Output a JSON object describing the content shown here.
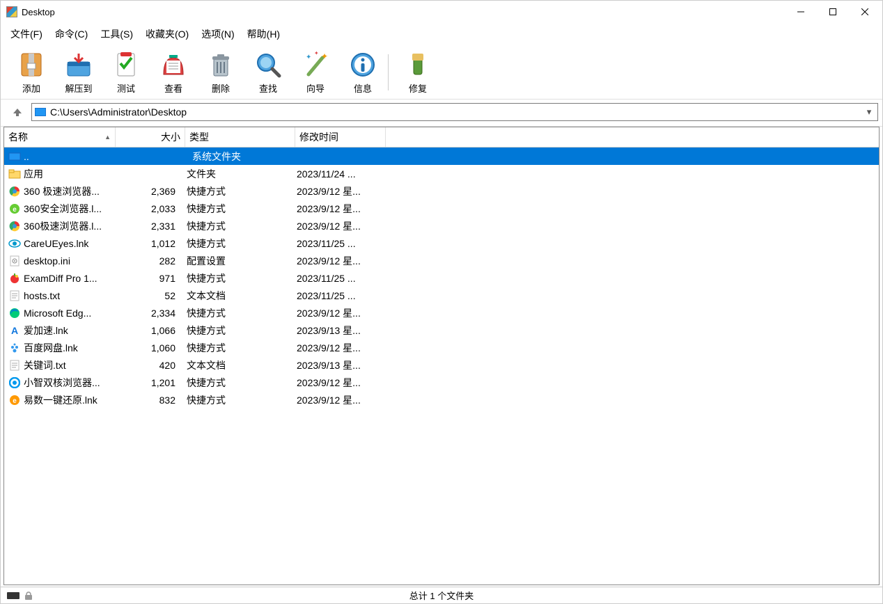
{
  "window": {
    "title": "Desktop"
  },
  "menu": {
    "file": "文件(F)",
    "commands": "命令(C)",
    "tools": "工具(S)",
    "favorites": "收藏夹(O)",
    "options": "选项(N)",
    "help": "帮助(H)"
  },
  "toolbar": {
    "add": "添加",
    "extract": "解压到",
    "test": "测试",
    "view": "查看",
    "delete": "删除",
    "find": "查找",
    "wizard": "向导",
    "info": "信息",
    "repair": "修复"
  },
  "address": {
    "path": "C:\\Users\\Administrator\\Desktop"
  },
  "columns": {
    "name": "名称",
    "size": "大小",
    "type": "类型",
    "modified": "修改时间"
  },
  "parent_row": {
    "name": "..",
    "type": "系统文件夹"
  },
  "files": [
    {
      "icon": "folder",
      "name": "应用",
      "size": "",
      "type": "文件夹",
      "date": "2023/11/24 ..."
    },
    {
      "icon": "chrome360",
      "name": "360 极速浏览器...",
      "size": "2,369",
      "type": "快捷方式",
      "date": "2023/9/12 星..."
    },
    {
      "icon": "green-e",
      "name": "360安全浏览器.l...",
      "size": "2,033",
      "type": "快捷方式",
      "date": "2023/9/12 星..."
    },
    {
      "icon": "chrome360",
      "name": "360极速浏览器.l...",
      "size": "2,331",
      "type": "快捷方式",
      "date": "2023/9/12 星..."
    },
    {
      "icon": "eye",
      "name": "CareUEyes.lnk",
      "size": "1,012",
      "type": "快捷方式",
      "date": "2023/11/25 ..."
    },
    {
      "icon": "ini",
      "name": "desktop.ini",
      "size": "282",
      "type": "配置设置",
      "date": "2023/9/12 星..."
    },
    {
      "icon": "apple",
      "name": "ExamDiff Pro 1...",
      "size": "971",
      "type": "快捷方式",
      "date": "2023/11/25 ..."
    },
    {
      "icon": "txt",
      "name": "hosts.txt",
      "size": "52",
      "type": "文本文档",
      "date": "2023/11/25 ..."
    },
    {
      "icon": "edge",
      "name": "Microsoft Edg...",
      "size": "2,334",
      "type": "快捷方式",
      "date": "2023/9/12 星..."
    },
    {
      "icon": "blue-a",
      "name": "爱加速.lnk",
      "size": "1,066",
      "type": "快捷方式",
      "date": "2023/9/13 星..."
    },
    {
      "icon": "baidu",
      "name": "百度网盘.lnk",
      "size": "1,060",
      "type": "快捷方式",
      "date": "2023/9/12 星..."
    },
    {
      "icon": "txt",
      "name": "关键词.txt",
      "size": "420",
      "type": "文本文档",
      "date": "2023/9/13 星..."
    },
    {
      "icon": "ering",
      "name": "小智双核浏览器...",
      "size": "1,201",
      "type": "快捷方式",
      "date": "2023/9/12 星..."
    },
    {
      "icon": "orange-e",
      "name": "易数一键还原.lnk",
      "size": "832",
      "type": "快捷方式",
      "date": "2023/9/12 星..."
    }
  ],
  "status": {
    "text": "总计 1 个文件夹"
  }
}
